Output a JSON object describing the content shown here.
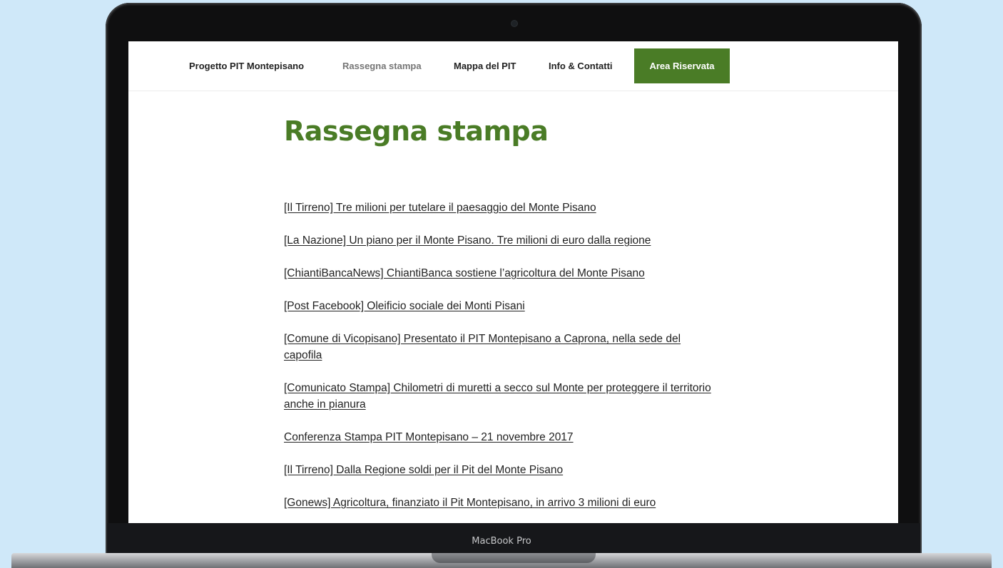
{
  "nav": {
    "items": [
      {
        "label": "Progetto PIT Montepisano"
      },
      {
        "label": "Rassegna stampa"
      },
      {
        "label": "Mappa del PIT"
      },
      {
        "label": "Info & Contatti"
      }
    ],
    "cta_label": "Area Riservata"
  },
  "page": {
    "title": "Rassegna stampa"
  },
  "articles": [
    "[Il Tirreno] Tre milioni per tutelare il paesaggio del Monte Pisano",
    "[La Nazione] Un piano per il Monte Pisano. Tre milioni di euro dalla regione",
    "[ChiantiBancaNews] ChiantiBanca sostiene l’agricoltura del Monte Pisano",
    "[Post Facebook] Oleificio sociale dei Monti Pisani",
    "[Comune di Vicopisano] Presentato il PIT Montepisano a Caprona, nella sede del capofila",
    "[Comunicato Stampa] Chilometri di muretti a secco sul Monte per proteggere il territorio anche in pianura",
    "Conferenza Stampa PIT Montepisano – 21 novembre 2017",
    "[Il Tirreno] Dalla Regione soldi per il Pit del Monte Pisano",
    "[Gonews] Agricoltura, finanziato il Pit Montepisano, in arrivo 3 milioni di euro"
  ],
  "device": {
    "brand_label": "MacBook Pro"
  },
  "colors": {
    "accent": "#4a7c26",
    "background": "#cfe8f9",
    "nav_current": "#767676"
  }
}
